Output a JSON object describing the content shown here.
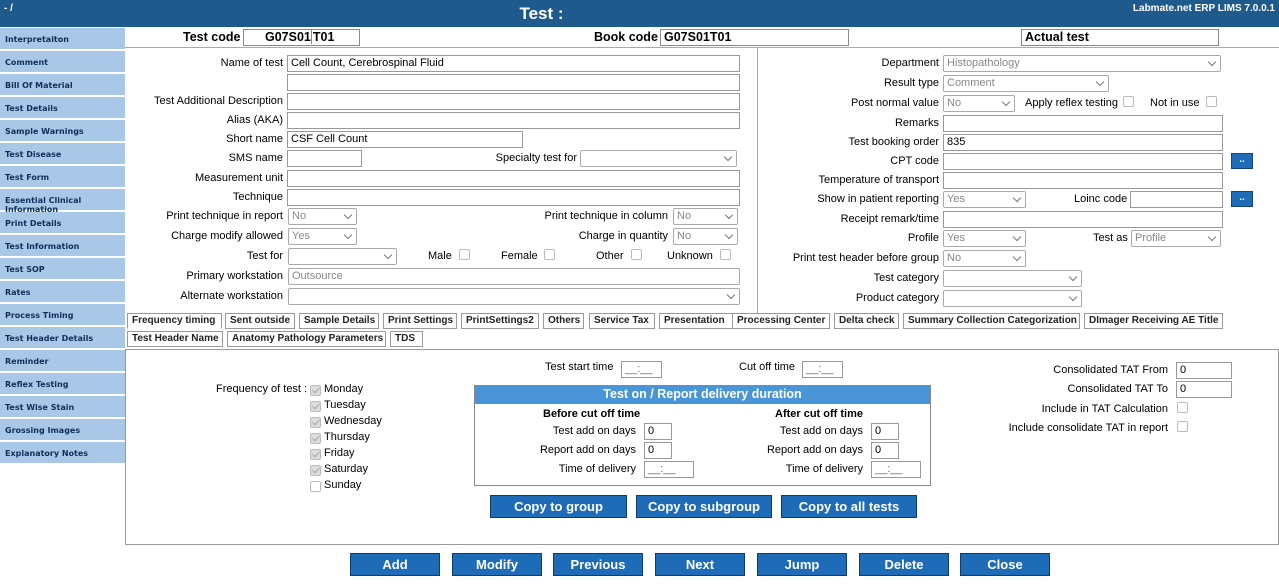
{
  "titlebar": {
    "corner": "- /",
    "title": "Test :",
    "version": "Labmate.net ERP LIMS 7.0.0.1"
  },
  "sidebar": {
    "items": [
      "Interpretaiton",
      "Comment",
      "Bill Of Material",
      "Test Details",
      "Sample Warnings",
      "Test Disease",
      "Test Form",
      "Essential Clinical Information",
      "Print Details",
      "Test Information",
      "Test SOP",
      "Rates",
      "Process Timing",
      "Test Header Details",
      "Reminder",
      "Reflex Testing",
      "Test Wise Stain",
      "Grossing Images",
      "Explanatory Notes"
    ]
  },
  "header": {
    "test_code_label": "Test code",
    "test_code_value": "G07S01",
    "test_code_suffix": "T01",
    "book_code_label": "Book code",
    "book_code_value": "G07S01T01",
    "actual_test": "Actual test"
  },
  "left": {
    "name_label": "Name of test",
    "name_value": "Cell Count, Cerebrospinal Fluid",
    "additional_label": "Test Additional Description",
    "alias_label": "Alias (AKA)",
    "short_label": "Short name",
    "short_value": "CSF Cell Count",
    "sms_label": "SMS name",
    "specialty_label": "Specialty test for",
    "unit_label": "Measurement unit",
    "technique_label": "Technique",
    "print_tech_label": "Print technique in report",
    "print_tech_value": "No",
    "print_tech_col_label": "Print technique in column",
    "print_tech_col_value": "No",
    "charge_modify_label": "Charge modify allowed",
    "charge_modify_value": "Yes",
    "charge_qty_label": "Charge in quantity",
    "charge_qty_value": "No",
    "test_for_label": "Test for",
    "male": "Male",
    "female": "Female",
    "other": "Other",
    "unknown": "Unknown",
    "primary_ws_label": "Primary workstation",
    "primary_ws_value": "Outsource",
    "alternate_ws_label": "Alternate workstation"
  },
  "right": {
    "department_label": "Department",
    "department_value": "Histopathology",
    "result_type_label": "Result type",
    "result_type_value": "Comment",
    "post_normal_label": "Post normal value",
    "post_normal_value": "No",
    "apply_reflex": "Apply reflex testing",
    "not_in_use": "Not in use",
    "remarks_label": "Remarks",
    "booking_order_label": "Test booking order",
    "booking_order_value": "835",
    "cpt_label": "CPT code",
    "temperature_label": "Temperature of transport",
    "show_patient_label": "Show in patient reporting",
    "show_patient_value": "Yes",
    "loinc_label": "Loinc code",
    "receipt_label": "Receipt remark/time",
    "profile_label": "Profile",
    "profile_value": "Yes",
    "test_as_label": "Test as",
    "test_as_value": "Profile",
    "print_header_label": "Print test header before group",
    "print_header_value": "No",
    "category_label": "Test category",
    "product_label": "Product category",
    "dots": ".."
  },
  "tabs": {
    "row1": [
      "Frequency timing",
      "Sent outside",
      "Sample Details",
      "Print Settings",
      "PrintSettings2",
      "Others",
      "Service Tax",
      "Presentation",
      "Processing Center",
      "Delta check",
      "Summary Collection Categorization",
      "DImager Receiving AE Title"
    ],
    "row2": [
      "Test Header Name",
      "Anatomy Pathology Parameters",
      "TDS"
    ]
  },
  "freq": {
    "label": "Frequency of test :",
    "days": [
      "Monday",
      "Tuesday",
      "Wednesday",
      "Thursday",
      "Friday",
      "Saturday",
      "Sunday"
    ],
    "start_time_label": "Test start time",
    "time_placeholder": "__:__",
    "cutoff_label": "Cut off time",
    "delivery_title": "Test on / Report delivery duration",
    "before_title": "Before cut off time",
    "after_title": "After cut off time",
    "test_add_label": "Test add on days",
    "report_add_label": "Report add on days",
    "time_delivery_label": "Time of delivery",
    "zero": "0",
    "tat_from_label": "Consolidated TAT From",
    "tat_to_label": "Consolidated TAT To",
    "include_tat_label": "Include in TAT Calculation",
    "include_cons_label": "Include consolidate TAT in report"
  },
  "copy_buttons": [
    "Copy to group",
    "Copy to subgroup",
    "Copy to all tests"
  ],
  "actions": [
    "Add",
    "Modify",
    "Previous",
    "Next",
    "Jump",
    "Delete",
    "Close"
  ]
}
